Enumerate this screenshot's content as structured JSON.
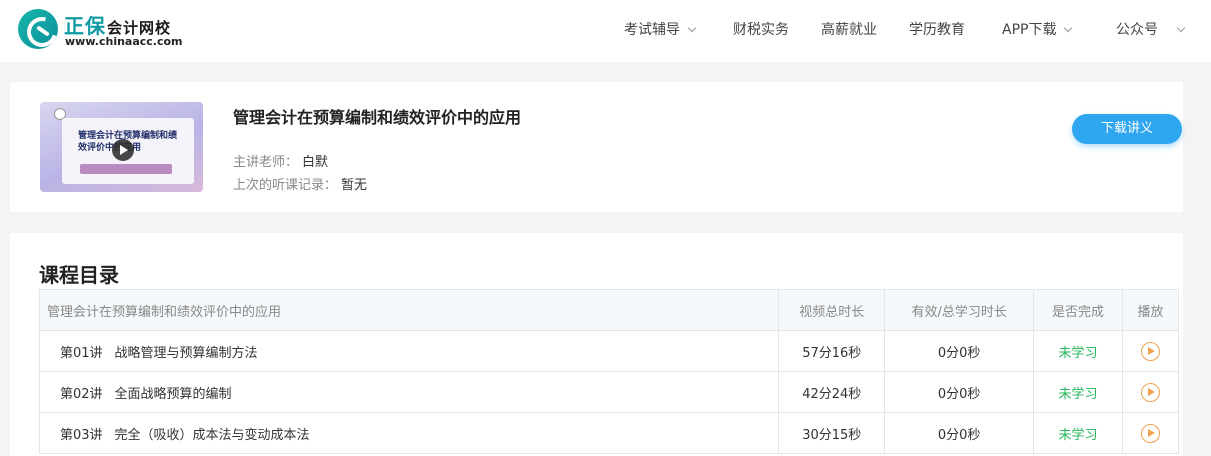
{
  "header": {
    "logo": {
      "brand": "正保",
      "brand_sub": "会计网校",
      "url": "www.chinaacc.com"
    },
    "nav": [
      {
        "label": "考试辅导",
        "has_dropdown": true
      },
      {
        "label": "财税实务",
        "has_dropdown": false
      },
      {
        "label": "高薪就业",
        "has_dropdown": false
      },
      {
        "label": "学历教育",
        "has_dropdown": false
      },
      {
        "label": "APP下载",
        "has_dropdown": true
      },
      {
        "label": "公众号",
        "has_dropdown": true
      }
    ]
  },
  "course": {
    "thumbnail_title": "管理会计在预算编制和绩效评价中的应用",
    "thumbnail_teacher": "主讲老师：白默",
    "title": "管理会计在预算编制和绩效评价中的应用",
    "teacher_label": "主讲老师：",
    "teacher_name": "白默",
    "last_record_label": "上次的听课记录：",
    "last_record_value": "暂无",
    "download_label": "下载讲义"
  },
  "catalog": {
    "heading": "课程目录",
    "columns": [
      "管理会计在预算编制和绩效评价中的应用",
      "视频总时长",
      "有效/总学习时长",
      "是否完成",
      "播放"
    ],
    "rows": [
      {
        "no": "第01讲",
        "name": "战略管理与预算编制方法",
        "duration": "57分16秒",
        "study": "0分0秒",
        "status": "未学习"
      },
      {
        "no": "第02讲",
        "name": "全面战略预算的编制",
        "duration": "42分24秒",
        "study": "0分0秒",
        "status": "未学习"
      },
      {
        "no": "第03讲",
        "name": "完全（吸收）成本法与变动成本法",
        "duration": "30分15秒",
        "study": "0分0秒",
        "status": "未学习"
      }
    ]
  },
  "colors": {
    "accent_blue": "#2fa6f0",
    "status_green": "#24b65a",
    "play_orange": "#f0a04f",
    "brand_teal": "#0f9aa4"
  }
}
